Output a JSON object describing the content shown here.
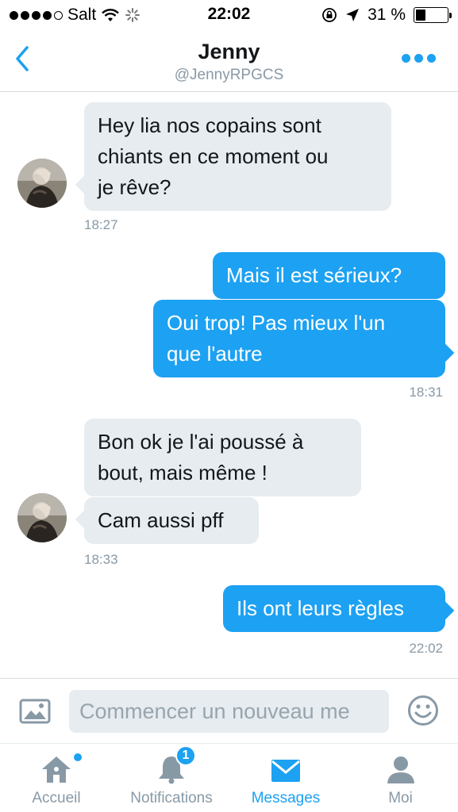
{
  "status_bar": {
    "carrier": "Salt",
    "time": "22:02",
    "battery_percent": "31 %",
    "battery_level": 0.31
  },
  "header": {
    "title": "Jenny",
    "handle": "@JennyRPGCS",
    "back_icon": "chevron-left-icon",
    "more_icon": "more-dots-icon"
  },
  "messages": [
    {
      "direction": "in",
      "text_lines": [
        "Hey lia nos copains sont",
        "chiants en ce moment ou",
        "je rêve?"
      ]
    },
    {
      "direction": "out",
      "text_lines": [
        "Mais il est sérieux?"
      ]
    },
    {
      "direction": "out",
      "text_lines": [
        "Oui trop! Pas mieux l'un",
        "que l'autre"
      ]
    },
    {
      "direction": "in",
      "text_lines": [
        "Bon ok je l'ai poussé à",
        "bout, mais même !"
      ]
    },
    {
      "direction": "in",
      "text_lines": [
        "Cam aussi pff"
      ]
    },
    {
      "direction": "out",
      "text_lines": [
        "Ils ont leurs règles"
      ]
    }
  ],
  "timestamps": [
    "18:27",
    "18:31",
    "18:33",
    "22:02"
  ],
  "composer": {
    "placeholder": "Commencer un nouveau me",
    "photo_icon": "photo-icon",
    "emoji_icon": "emoji-icon"
  },
  "tabs": [
    {
      "label": "Accueil",
      "icon": "home-icon",
      "active": false,
      "badge": "dot"
    },
    {
      "label": "Notifications",
      "icon": "bell-icon",
      "active": false,
      "badge": "1"
    },
    {
      "label": "Messages",
      "icon": "envelope-icon",
      "active": true
    },
    {
      "label": "Moi",
      "icon": "person-icon",
      "active": false
    }
  ],
  "colors": {
    "accent": "#1da1f2",
    "incoming_bubble": "#e6ecf0",
    "muted_text": "#8899a6"
  }
}
